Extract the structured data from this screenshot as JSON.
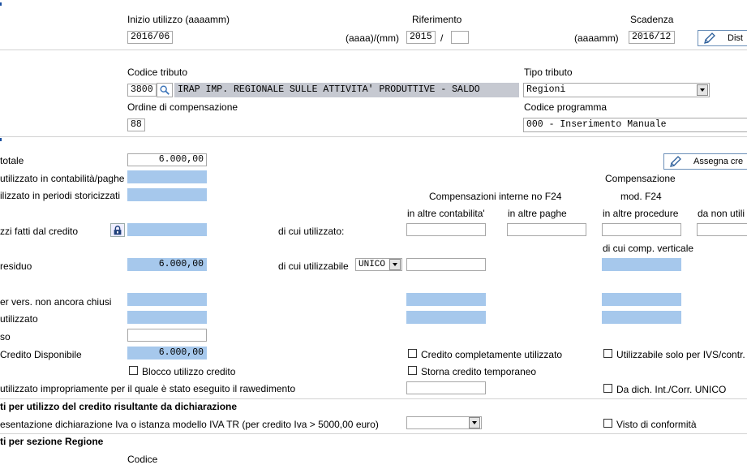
{
  "periodo": {
    "inizio_label": "Inizio utilizzo (aaaamm)",
    "inizio_value": "2016/06",
    "riferimento_label": "Riferimento",
    "riferimento_format": "(aaaa)/(mm)",
    "riferimento_year": "2015",
    "riferimento_sep": "/",
    "riferimento_month": "",
    "scadenza_label": "Scadenza",
    "scadenza_format": "(aaaamm)",
    "scadenza_value": "2016/12",
    "dist_button": "Dist"
  },
  "tributo": {
    "codice_label": "Codice tributo",
    "codice_value": "3800",
    "descrizione": "IRAP  IMP. REGIONALE SULLE ATTIVITA' PRODUTTIVE - SALDO",
    "tipo_label": "Tipo tributo",
    "tipo_value": "Regioni",
    "ordine_label": "Ordine di compensazione",
    "ordine_value": "88",
    "programma_label": "Codice programma",
    "programma_value": "000 - Inserimento Manuale"
  },
  "credito": {
    "totale_label": "totale",
    "totale_value": "6.000,00",
    "assegna_button": "Assegna cre",
    "contab_label": "utilizzato in contabilità/paghe",
    "storicizzati_label": "ilizzato in periodi storicizzati",
    "fatti_label": "zzi fatti dal credito",
    "residuo_label": " residuo",
    "residuo_value": "6.000,00",
    "vers_label": "er vers. non ancora chiusi",
    "utilizzato_label": "utilizzato",
    "so_label": "so",
    "disponibile_label": "Credito Disponibile",
    "disponibile_value": "6.000,00",
    "blocco_label": "Blocco utilizzo credito",
    "rawed_label": "utilizzato impropriamente per il quale è stato eseguito il rawedimento"
  },
  "compensazioni": {
    "interne_header": "Compensazioni interne no F24",
    "comp_header": "Compensazione",
    "f24_header": "mod. F24",
    "altre_contabilita": "in altre contabilita'",
    "altre_paghe": "in altre paghe",
    "altre_procedure": "in altre procedure",
    "da_non": "da non utili",
    "di_cui_utilizzato": "di cui utilizzato:",
    "di_cui_verticale": "di cui comp. verticale",
    "di_cui_utilizzabile": "di cui utilizzabile",
    "utilizzabile_select": "UNICO"
  },
  "checkboxes": {
    "completamente": "Credito completamente utilizzato",
    "ivs": "Utilizzabile solo per IVS/contr.",
    "storna": "Storna credito temporaneo",
    "dich": "Da dich. Int./Corr. UNICO",
    "visto": "Visto di conformità"
  },
  "dichiarazione": {
    "section_title": "ti per utilizzo del credito risultante da dichiarazione",
    "presentazione_label": "esentazione dichiarazione Iva o istanza modello IVA TR (per credito Iva > 5000,00 euro)",
    "presentazione_value": ""
  },
  "regione": {
    "section_title": "ti per sezione Regione",
    "codice_label": "Codice"
  },
  "colors": {
    "field_blue": "#a6c8ec",
    "border": "#a7a7a7",
    "button_border": "#6b8fb8"
  }
}
